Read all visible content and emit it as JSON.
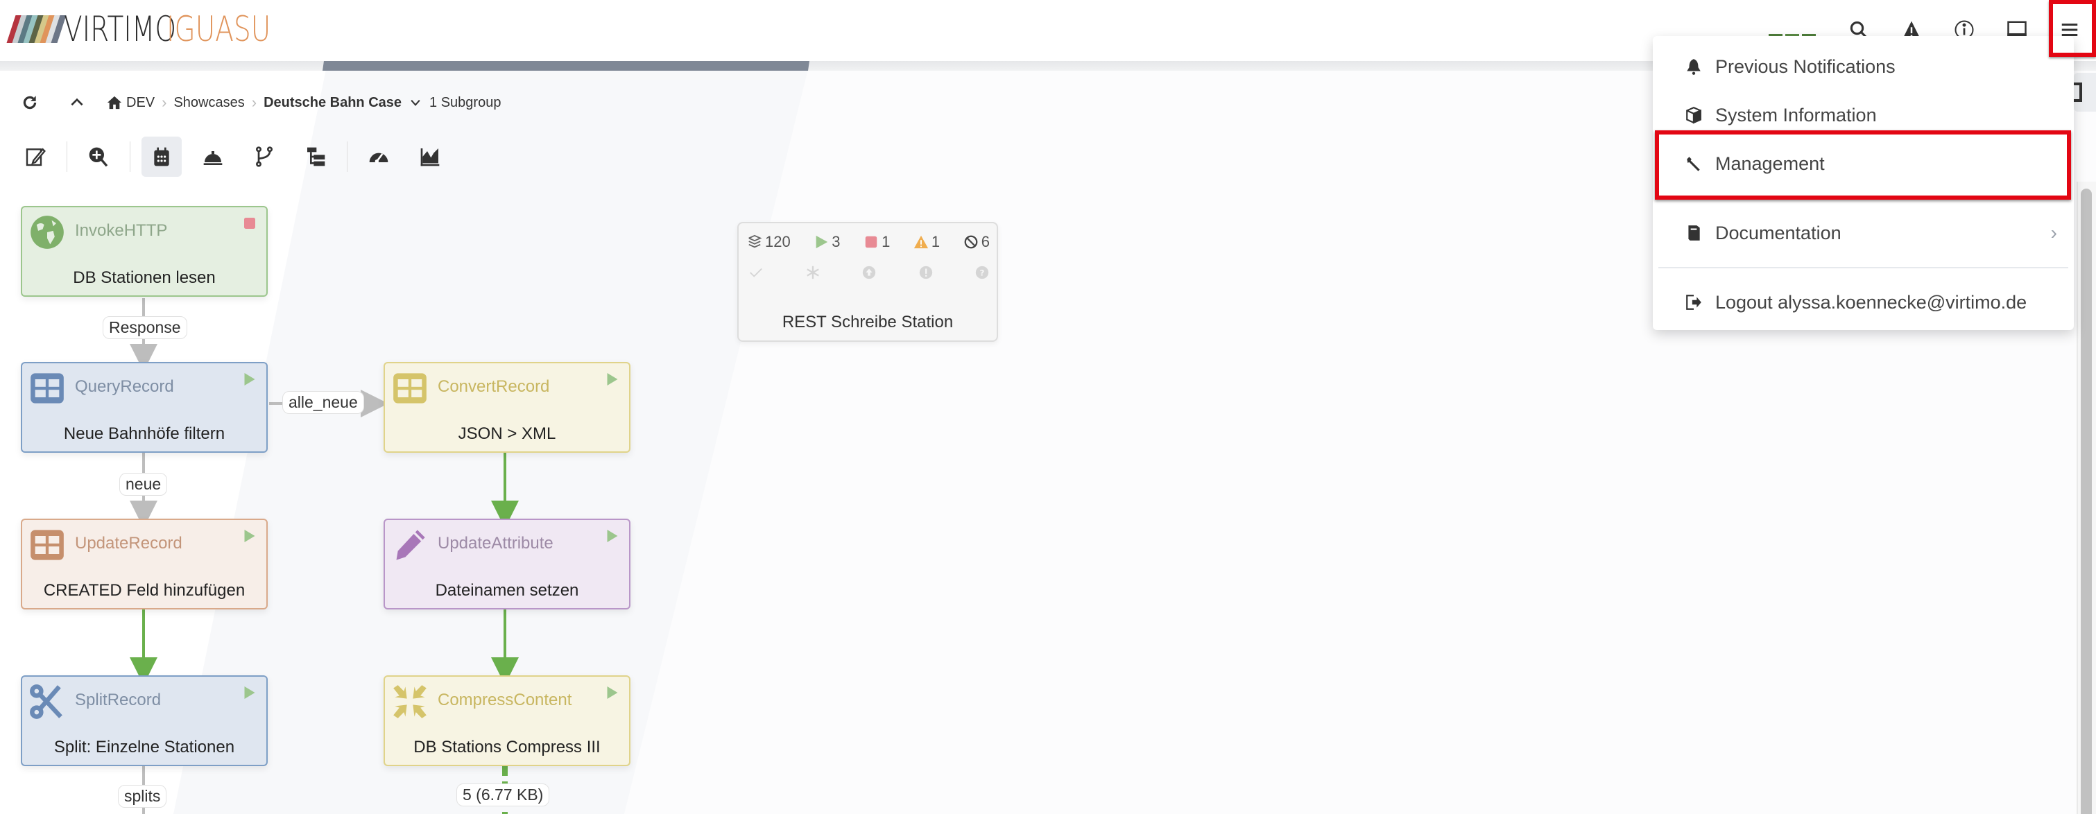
{
  "brand": {
    "name": "VIRTIMO",
    "product": "IGUASU",
    "mark_colors": [
      "#b5343f",
      "#c7cdd1",
      "#5b7a84",
      "#97c3c2",
      "#5d6446",
      "#d5c88a",
      "#e0945b",
      "#dfe1e3",
      "#6d7686"
    ]
  },
  "header": {
    "icons": [
      {
        "name": "search-icon"
      },
      {
        "name": "alert-icon"
      },
      {
        "name": "info-icon"
      },
      {
        "name": "monitor-icon"
      },
      {
        "name": "hamburger-menu-icon"
      }
    ]
  },
  "breadcrumb": {
    "items": [
      "DEV",
      "Showcases",
      "Deutsche Bahn Case"
    ],
    "subgroup_label": "1 Subgroup"
  },
  "toolbar": {
    "buttons": [
      {
        "name": "edit-icon",
        "active": false
      },
      {
        "name": "zoom-in-icon",
        "active": false
      },
      {
        "name": "calendar-icon",
        "active": true
      },
      {
        "name": "service-bell-icon",
        "active": false
      },
      {
        "name": "branch-icon",
        "active": false
      },
      {
        "name": "hierarchy-icon",
        "active": false
      },
      {
        "name": "gauge-icon",
        "active": false
      },
      {
        "name": "area-chart-icon",
        "active": false
      }
    ]
  },
  "processors": [
    {
      "type": "InvokeHTTP",
      "name": "DB Stationen lesen",
      "state": "stopped",
      "color": "green"
    },
    {
      "type": "QueryRecord",
      "name": "Neue Bahnhöfe filtern",
      "state": "running",
      "color": "blue"
    },
    {
      "type": "ConvertRecord",
      "name": "JSON > XML",
      "state": "running",
      "color": "yellow"
    },
    {
      "type": "UpdateRecord",
      "name": "CREATED Feld hinzufügen",
      "state": "running",
      "color": "orange"
    },
    {
      "type": "UpdateAttribute",
      "name": "Dateinamen setzen",
      "state": "running",
      "color": "purple"
    },
    {
      "type": "SplitRecord",
      "name": "Split: Einzelne Stationen",
      "state": "running",
      "color": "blue"
    },
    {
      "type": "CompressContent",
      "name": "DB Stations Compress III",
      "state": "running",
      "color": "yellow"
    }
  ],
  "connections": {
    "response": "Response",
    "alle_neue": "alle_neue",
    "neue": "neue",
    "splits": "splits",
    "queued": "5 (6.77 KB)"
  },
  "process_group": {
    "name": "REST Schreibe Station",
    "stats": {
      "queued": "120",
      "running": "3",
      "stopped": "1",
      "invalid": "1",
      "disabled": "6"
    }
  },
  "menu": {
    "items": [
      {
        "label": "Previous Notifications",
        "icon": "bell-icon"
      },
      {
        "label": "System Information",
        "icon": "box-icon"
      },
      {
        "label": "Management",
        "icon": "wrench-icon",
        "highlighted": true
      },
      {
        "label": "Documentation",
        "icon": "book-icon",
        "has_submenu": true
      },
      {
        "label": "Logout alyssa.koennecke@virtimo.de",
        "icon": "logout-icon"
      }
    ]
  },
  "colors": {
    "highlight": "#e30613",
    "success_line": "#6ab04c",
    "neutral_line": "#bdbdbd",
    "brand_accent": "#e0945b"
  }
}
